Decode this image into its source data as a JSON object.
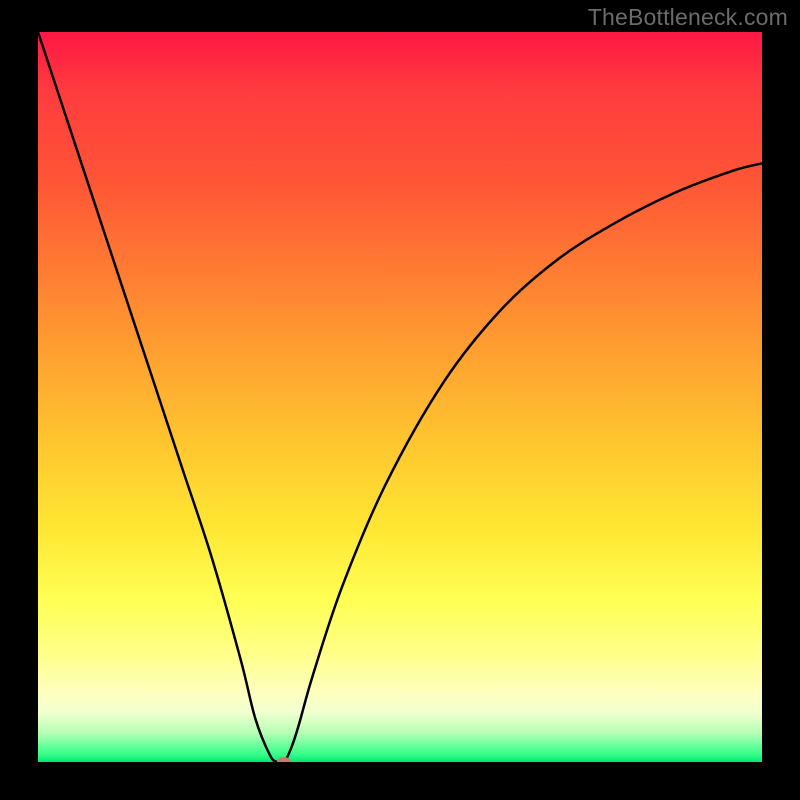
{
  "watermark": "TheBottleneck.com",
  "chart_data": {
    "type": "line",
    "title": "",
    "xlabel": "",
    "ylabel": "",
    "xlim": [
      0,
      100
    ],
    "ylim": [
      0,
      100
    ],
    "grid": false,
    "background_gradient": {
      "top": "#ff1744",
      "middle": "#ffe733",
      "bottom": "#00e676"
    },
    "series": [
      {
        "name": "bottleneck-curve",
        "color": "#000000",
        "x": [
          0,
          4,
          8,
          12,
          16,
          20,
          24,
          28,
          30,
          32,
          33,
          34,
          35,
          36,
          38,
          42,
          48,
          56,
          64,
          72,
          80,
          88,
          96,
          100
        ],
        "y": [
          100,
          88,
          76,
          64,
          52,
          40,
          28,
          14,
          6,
          1,
          0,
          0,
          2,
          5,
          12,
          24,
          38,
          52,
          62,
          69,
          74,
          78,
          81,
          82
        ]
      }
    ],
    "marker": {
      "name": "operating-point",
      "x": 34,
      "y": 0,
      "color": "#c97a6a"
    }
  }
}
